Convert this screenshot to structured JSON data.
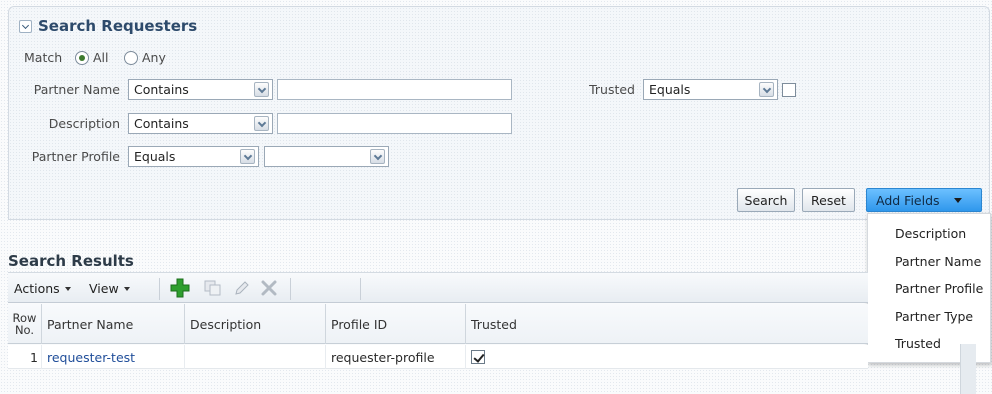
{
  "search": {
    "title": "Search Requesters",
    "match": {
      "label": "Match",
      "all_label": "All",
      "any_label": "Any",
      "selected": "All"
    },
    "fields": {
      "partner_name": {
        "label": "Partner Name",
        "operator": "Contains",
        "value": ""
      },
      "description": {
        "label": "Description",
        "operator": "Contains",
        "value": ""
      },
      "partner_profile": {
        "label": "Partner Profile",
        "operator": "Equals",
        "value": ""
      },
      "trusted": {
        "label": "Trusted",
        "operator": "Equals",
        "checked": false
      }
    },
    "buttons": {
      "search": "Search",
      "reset": "Reset",
      "add_fields": "Add Fields"
    }
  },
  "add_fields_menu": {
    "items": [
      "Description",
      "Partner Name",
      "Partner Profile",
      "Partner Type",
      "Trusted"
    ]
  },
  "results": {
    "title": "Search Results",
    "toolbar": {
      "actions": "Actions",
      "view": "View"
    },
    "columns": [
      "Row No.",
      "Partner Name",
      "Description",
      "Profile ID",
      "Trusted"
    ],
    "column_row_no_line1": "Row",
    "column_row_no_line2": "No.",
    "rows": [
      {
        "row_no": "1",
        "partner_name": "requester-test",
        "description": "",
        "profile_id": "requester-profile",
        "trusted": true
      }
    ]
  },
  "colors": {
    "accent": "#2f97ec",
    "link": "#1f4d99",
    "title": "#2d4a6b",
    "add_icon": "#2e9e2e"
  }
}
